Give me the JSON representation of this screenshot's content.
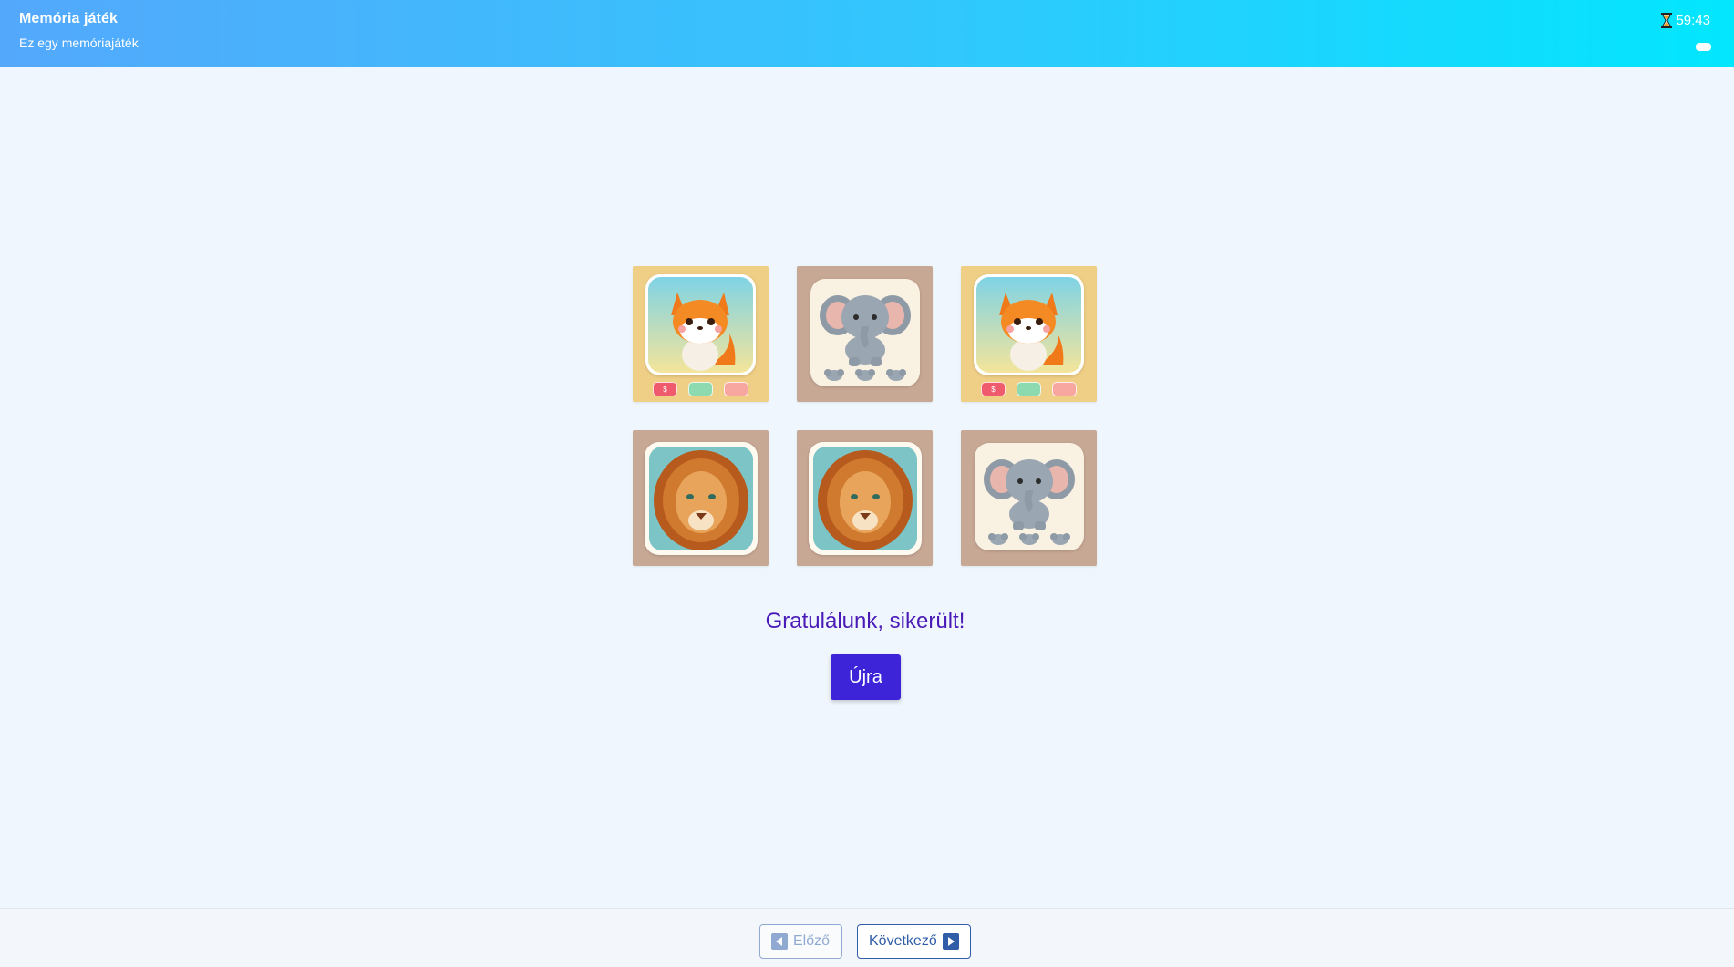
{
  "header": {
    "title": "Memória játék",
    "subtitle": "Ez egy memóriajáték",
    "timer": "59:43",
    "timer_icon": "hourglass-icon"
  },
  "cards": [
    {
      "animal": "fox",
      "icon": "fox-icon",
      "badge_label": "$"
    },
    {
      "animal": "elephant",
      "icon": "elephant-icon"
    },
    {
      "animal": "fox",
      "icon": "fox-icon",
      "badge_label": "$"
    },
    {
      "animal": "lion",
      "icon": "lion-icon"
    },
    {
      "animal": "lion",
      "icon": "lion-icon"
    },
    {
      "animal": "elephant",
      "icon": "elephant-icon"
    }
  ],
  "message": "Gratulálunk, sikerült!",
  "retry_label": "Újra",
  "footer": {
    "prev_label": "Előző",
    "next_label": "Következő"
  },
  "colors": {
    "accent": "#3d24d8",
    "message": "#4a1ab7",
    "nav": "#2f5da8",
    "header_gradient_start": "#54a8fc",
    "header_gradient_end": "#02e6fe"
  }
}
